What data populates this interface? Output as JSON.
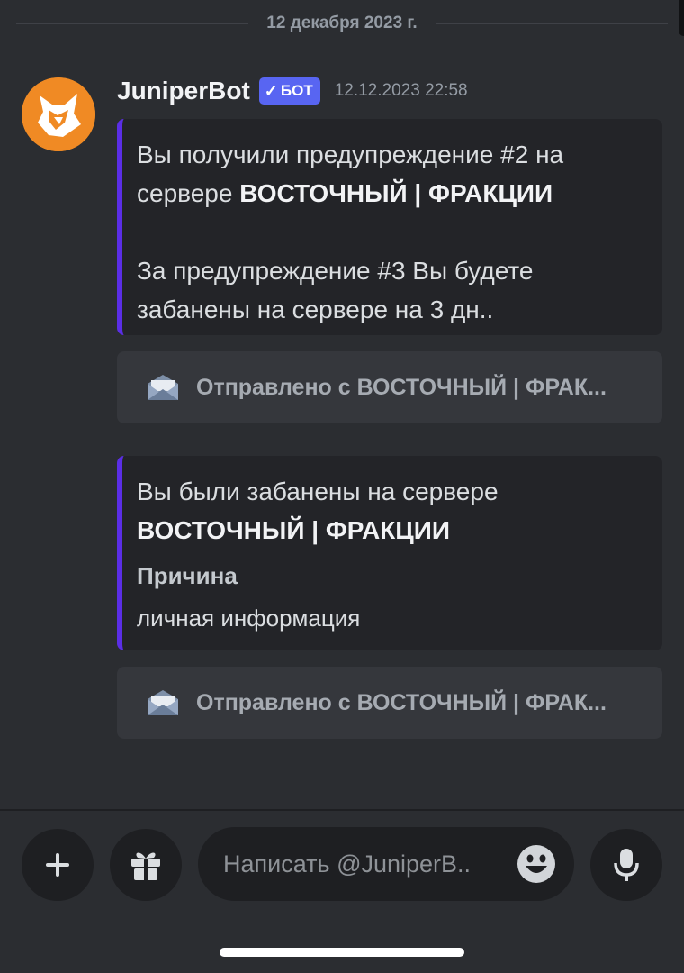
{
  "date_divider": "12 декабря 2023 г.",
  "message": {
    "author": "JuniperBot",
    "badge": "БОТ",
    "badge_check": "✓",
    "timestamp": "12.12.2023 22:58",
    "avatar_icon": "fox-icon",
    "avatar_color": "#f08a24"
  },
  "embed1": {
    "line1_prefix": "Вы получили предупреждение #2 на сервере ",
    "line1_bold": "ВОСТОЧНЫЙ | ФРАКЦИИ",
    "line2": "За предупреждение #3 Вы будете забанены на сервере на 3 дн..",
    "accent_color": "#5b2ee6"
  },
  "sent1": {
    "label": "Отправлено с ВОСТОЧНЫЙ | ФРАК...",
    "icon": "envelope-icon"
  },
  "embed2": {
    "line1": "Вы были забанены на сервере",
    "line1_bold": "ВОСТОЧНЫЙ | ФРАКЦИИ",
    "field_name": "Причина",
    "field_value": "личная информация"
  },
  "sent2": {
    "label": "Отправлено с ВОСТОЧНЫЙ | ФРАК...",
    "icon": "envelope-icon"
  },
  "composer": {
    "placeholder": "Написать @JuniperB..",
    "plus_icon": "plus-icon",
    "gift_icon": "gift-icon",
    "emoji_icon": "emoji-icon",
    "mic_icon": "microphone-icon"
  }
}
